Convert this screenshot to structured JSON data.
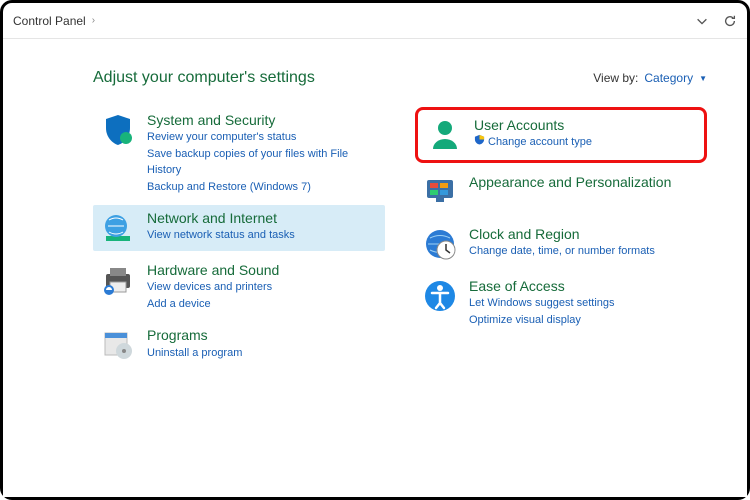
{
  "titlebar": {
    "breadcrumb": "Control Panel"
  },
  "heading": "Adjust your computer's settings",
  "viewby": {
    "label": "View by:",
    "value": "Category"
  },
  "left": [
    {
      "icon": "shield-icon",
      "title": "System and Security",
      "links": [
        "Review your computer's status",
        "Save backup copies of your files with File History",
        "Backup and Restore (Windows 7)"
      ],
      "selected": false
    },
    {
      "icon": "globe-icon",
      "title": "Network and Internet",
      "links": [
        "View network status and tasks"
      ],
      "selected": true
    },
    {
      "icon": "printer-icon",
      "title": "Hardware and Sound",
      "links": [
        "View devices and printers",
        "Add a device"
      ],
      "selected": false
    },
    {
      "icon": "programs-icon",
      "title": "Programs",
      "links": [
        "Uninstall a program"
      ],
      "selected": false
    }
  ],
  "right": [
    {
      "icon": "user-icon",
      "title": "User Accounts",
      "links": [
        "Change account type"
      ],
      "shield_on": [
        0
      ],
      "boxed": true
    },
    {
      "icon": "appearance-icon",
      "title": "Appearance and Personalization",
      "links": []
    },
    {
      "icon": "clock-icon",
      "title": "Clock and Region",
      "links": [
        "Change date, time, or number formats"
      ]
    },
    {
      "icon": "ease-icon",
      "title": "Ease of Access",
      "links": [
        "Let Windows suggest settings",
        "Optimize visual display"
      ]
    }
  ]
}
